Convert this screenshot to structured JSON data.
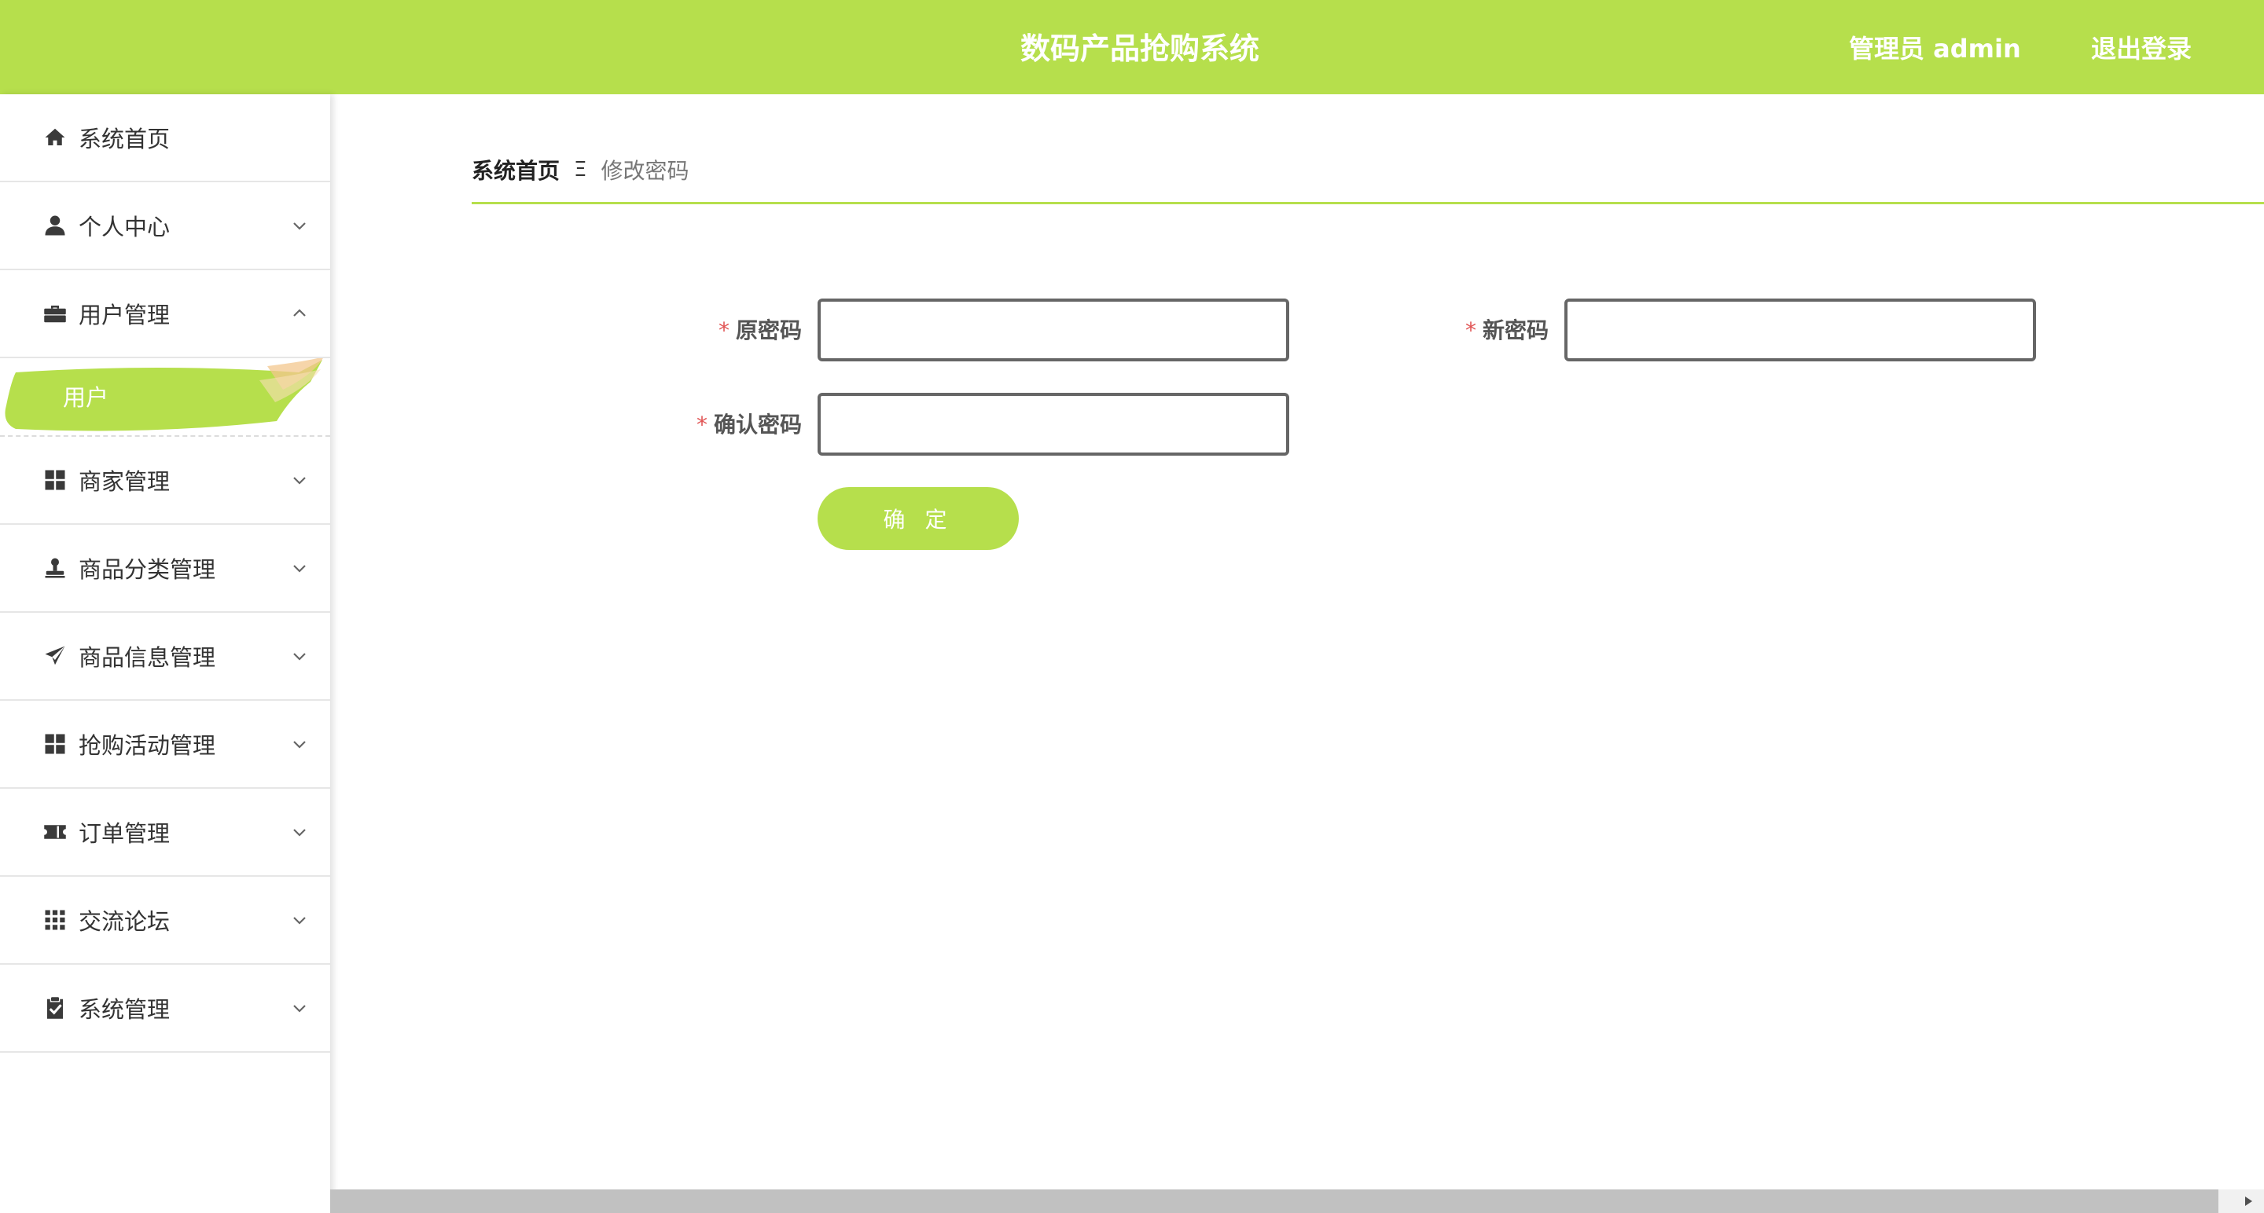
{
  "header": {
    "title": "数码产品抢购系统",
    "user": "管理员 admin",
    "logout": "退出登录",
    "bg_color": "#b6df4c"
  },
  "sidebar": {
    "items": [
      {
        "label": "系统首页",
        "icon": "home-icon"
      },
      {
        "label": "个人中心",
        "icon": "user-icon",
        "chevron": "down"
      },
      {
        "label": "用户管理",
        "icon": "briefcase-icon",
        "chevron": "up",
        "expanded": true,
        "children": [
          {
            "label": "用户",
            "active": true
          }
        ]
      },
      {
        "label": "商家管理",
        "icon": "grid-icon",
        "chevron": "down"
      },
      {
        "label": "商品分类管理",
        "icon": "stamp-icon",
        "chevron": "down"
      },
      {
        "label": "商品信息管理",
        "icon": "paper-plane-icon",
        "chevron": "down"
      },
      {
        "label": "抢购活动管理",
        "icon": "grid-icon",
        "chevron": "down"
      },
      {
        "label": "订单管理",
        "icon": "ticket-icon",
        "chevron": "down"
      },
      {
        "label": "交流论坛",
        "icon": "grid-9-icon",
        "chevron": "down"
      },
      {
        "label": "系统管理",
        "icon": "clipboard-check-icon",
        "chevron": "down"
      }
    ]
  },
  "breadcrumb": {
    "home": "系统首页",
    "separator": "Ξ",
    "current": "修改密码"
  },
  "form": {
    "required_mark": "*",
    "old_password": {
      "label": "原密码",
      "value": ""
    },
    "new_password": {
      "label": "新密码",
      "value": ""
    },
    "confirm_password": {
      "label": "确认密码",
      "value": ""
    },
    "submit_label": "确 定"
  },
  "accent_color": "#b6df4c",
  "required_color": "#e15555"
}
